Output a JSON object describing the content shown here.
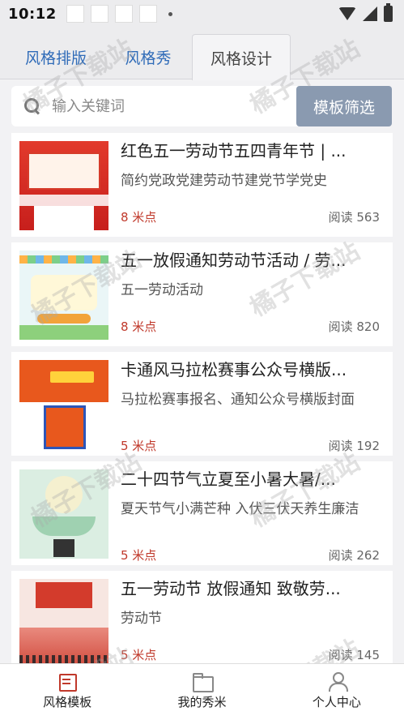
{
  "status": {
    "time": "10:12"
  },
  "tabs": [
    {
      "label": "风格排版"
    },
    {
      "label": "风格秀"
    },
    {
      "label": "风格设计"
    }
  ],
  "search": {
    "placeholder": "输入关键词",
    "filter_label": "模板筛选"
  },
  "items": [
    {
      "title": "红色五一劳动节五四青年节 | ...",
      "desc": "简约党政党建劳动节建党节学党史",
      "price": "8 米点",
      "reads": "阅读 563"
    },
    {
      "title": "五一放假通知劳动节活动 / 劳...",
      "desc": "五一劳动活动",
      "price": "8 米点",
      "reads": "阅读 820"
    },
    {
      "title": "卡通风马拉松赛事公众号横版...",
      "desc": "马拉松赛事报名、通知公众号横版封面",
      "price": "5 米点",
      "reads": "阅读 192"
    },
    {
      "title": "二十四节气立夏至小暑大暑/...",
      "desc": "夏天节气小满芒种 入伏三伏天养生廉洁",
      "price": "5 米点",
      "reads": "阅读 262"
    },
    {
      "title": "五一劳动节 放假通知 致敬劳...",
      "desc": "劳动节",
      "price": "5 米点",
      "reads": "阅读 145"
    }
  ],
  "bottom_nav": [
    {
      "label": "风格模板"
    },
    {
      "label": "我的秀米"
    },
    {
      "label": "个人中心"
    }
  ],
  "watermark": "橘子下载站",
  "colors": {
    "tab_active": "#2f6bb8",
    "price": "#c0392b",
    "filter_button": "#8a9ab0"
  }
}
